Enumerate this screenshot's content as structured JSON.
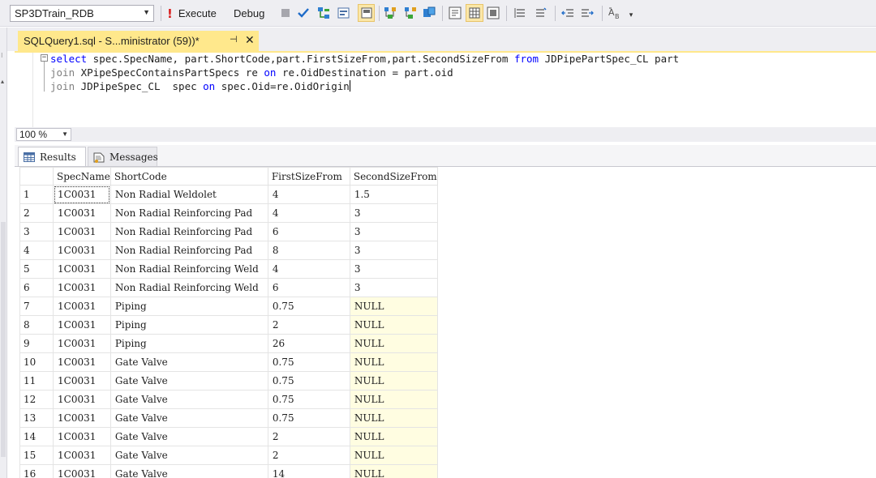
{
  "toolbar": {
    "database": "SP3DTrain_RDB",
    "execute_label": "Execute",
    "debug_label": "Debug"
  },
  "tab": {
    "title": "SQLQuery1.sql - S...ministrator (59))*",
    "pin": "⊣",
    "close": "✕"
  },
  "editor": {
    "lines": [
      {
        "parts": [
          [
            "kw",
            "select"
          ],
          [
            "t",
            " spec.SpecName, part.ShortCode,part.FirstSizeFrom,part.SecondSizeFrom "
          ],
          [
            "kw",
            "from"
          ],
          [
            "t",
            " JDPipePartSpec_CL part"
          ]
        ]
      },
      {
        "parts": [
          [
            "kw-gray",
            "join"
          ],
          [
            "t",
            " XPipeSpecContainsPartSpecs re "
          ],
          [
            "kw",
            "on"
          ],
          [
            "t",
            " re.OidDestination = part.oid"
          ]
        ]
      },
      {
        "parts": [
          [
            "kw-gray",
            "join"
          ],
          [
            "t",
            " JDPipeSpec_CL  spec "
          ],
          [
            "kw",
            "on"
          ],
          [
            "t",
            " spec.Oid=re.OidOrigin"
          ]
        ]
      }
    ]
  },
  "zoom": "100 %",
  "results_tabs": {
    "results": "Results",
    "messages": "Messages"
  },
  "grid": {
    "columns": [
      "",
      "SpecName",
      "ShortCode",
      "FirstSizeFrom",
      "SecondSizeFrom"
    ],
    "rows": [
      [
        "1",
        "1C0031",
        "Non Radial Weldolet",
        "4",
        "1.5"
      ],
      [
        "2",
        "1C0031",
        "Non Radial Reinforcing Pad",
        "4",
        "3"
      ],
      [
        "3",
        "1C0031",
        "Non Radial Reinforcing Pad",
        "6",
        "3"
      ],
      [
        "4",
        "1C0031",
        "Non Radial Reinforcing Pad",
        "8",
        "3"
      ],
      [
        "5",
        "1C0031",
        "Non Radial Reinforcing Weld",
        "4",
        "3"
      ],
      [
        "6",
        "1C0031",
        "Non Radial Reinforcing Weld",
        "6",
        "3"
      ],
      [
        "7",
        "1C0031",
        "Piping",
        "0.75",
        "NULL"
      ],
      [
        "8",
        "1C0031",
        "Piping",
        "2",
        "NULL"
      ],
      [
        "9",
        "1C0031",
        "Piping",
        "26",
        "NULL"
      ],
      [
        "10",
        "1C0031",
        "Gate Valve",
        "0.75",
        "NULL"
      ],
      [
        "11",
        "1C0031",
        "Gate Valve",
        "0.75",
        "NULL"
      ],
      [
        "12",
        "1C0031",
        "Gate Valve",
        "0.75",
        "NULL"
      ],
      [
        "13",
        "1C0031",
        "Gate Valve",
        "0.75",
        "NULL"
      ],
      [
        "14",
        "1C0031",
        "Gate Valve",
        "2",
        "NULL"
      ],
      [
        "15",
        "1C0031",
        "Gate Valve",
        "2",
        "NULL"
      ],
      [
        "16",
        "1C0031",
        "Gate Valve",
        "14",
        "NULL"
      ]
    ]
  },
  "colors": {
    "tab_highlight": "#ffe88c",
    "null_cell": "#fffde1",
    "keyword": "#0000ff",
    "keyword_join": "#808080"
  }
}
